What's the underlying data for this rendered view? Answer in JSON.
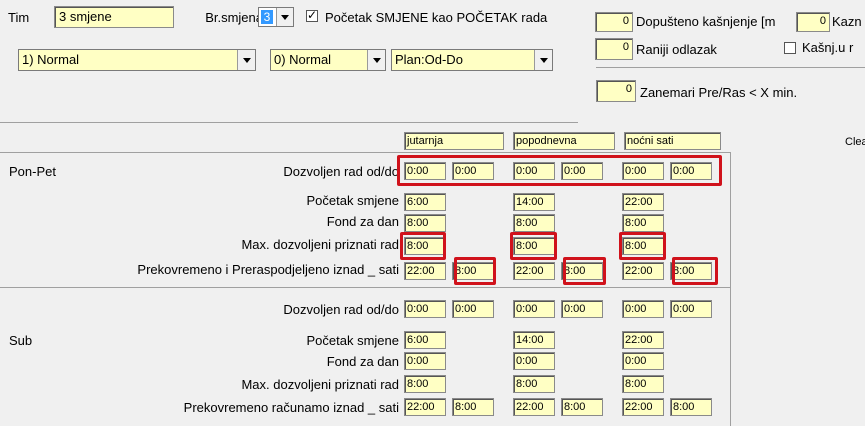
{
  "top": {
    "tim_label": "Tim",
    "tim_value": "3 smjene",
    "br_smjena_label": "Br.smjena",
    "br_smjena_value": "3",
    "pocetak_label": "Početak SMJENE kao POČETAK rada",
    "pocetak_checked": true,
    "dropdown1": "1) Normal",
    "dropdown2": "0) Normal",
    "dropdown3": "Plan:Od-Do"
  },
  "right": {
    "dopusteno_value": "0",
    "dopusteno_label": "Dopušteno kašnjenje [m",
    "kazn_value": "0",
    "kazn_label": "Kazn",
    "raniji_value": "0",
    "raniji_label": "Raniji odlazak",
    "kasnj_label": "Kašnj.u r",
    "kasnj_checked": false,
    "zanemari_value": "0",
    "zanemari_label": "Zanemari Pre/Ras < X min."
  },
  "clear_label": "Clea",
  "columns": [
    "jutarnja",
    "popodnevna",
    "noćni sati"
  ],
  "ponpet": {
    "section": "Pon-Pet",
    "labels": [
      "Dozvoljen rad od/do",
      "Početak smjene",
      "Fond za dan",
      "Max. dozvoljeni priznati rad",
      "Prekovremeno i Preraspodjeljeno iznad _ sati"
    ],
    "dozvoljen": [
      [
        "0:00",
        "0:00"
      ],
      [
        "0:00",
        "0:00"
      ],
      [
        "0:00",
        "0:00"
      ]
    ],
    "pocetak": [
      "6:00",
      "14:00",
      "22:00"
    ],
    "fond": [
      "8:00",
      "8:00",
      "8:00"
    ],
    "max": [
      "8:00",
      "8:00",
      "8:00"
    ],
    "prekovremeno": [
      [
        "22:00",
        "8:00"
      ],
      [
        "22:00",
        "8:00"
      ],
      [
        "22:00",
        "8:00"
      ]
    ]
  },
  "sub": {
    "section": "Sub",
    "labels": [
      "Dozvoljen rad od/do",
      "Početak smjene",
      "Fond za dan",
      "Max. dozvoljeni priznati rad",
      "Prekovremeno računamo iznad _ sati"
    ],
    "dozvoljen": [
      [
        "0:00",
        "0:00"
      ],
      [
        "0:00",
        "0:00"
      ],
      [
        "0:00",
        "0:00"
      ]
    ],
    "pocetak": [
      "6:00",
      "14:00",
      "22:00"
    ],
    "fond": [
      "0:00",
      "0:00",
      "0:00"
    ],
    "max": [
      "8:00",
      "8:00",
      "8:00"
    ],
    "prekovremeno": [
      [
        "22:00",
        "8:00"
      ],
      [
        "22:00",
        "8:00"
      ],
      [
        "22:00",
        "8:00"
      ]
    ]
  }
}
